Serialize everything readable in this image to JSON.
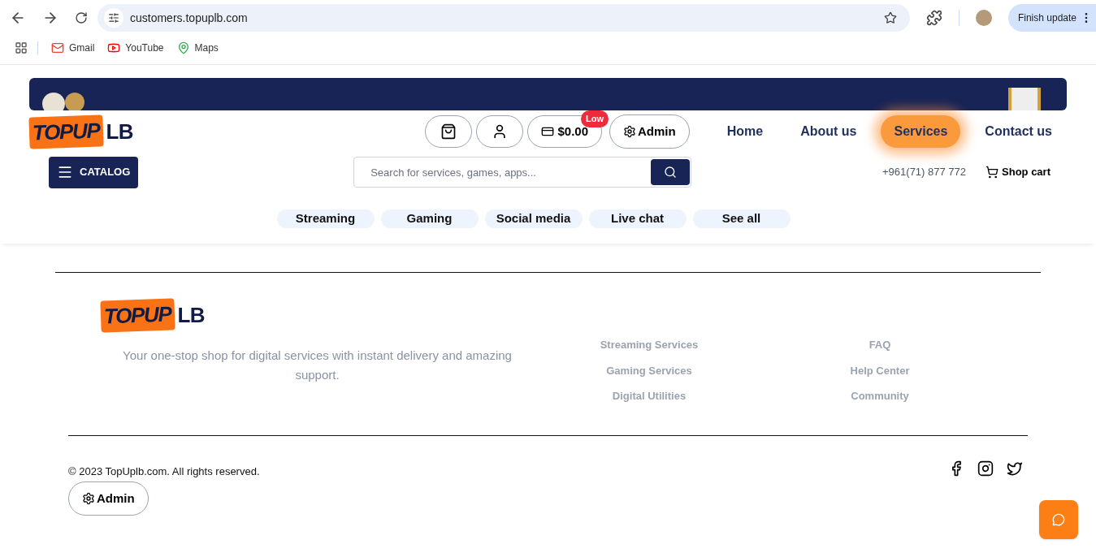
{
  "browser": {
    "url": "customers.topuplb.com",
    "update_button": "Finish update",
    "bookmarks": [
      {
        "label": "Gmail",
        "kind": "gmail"
      },
      {
        "label": "YouTube",
        "kind": "youtube"
      },
      {
        "label": "Maps",
        "kind": "maps"
      }
    ]
  },
  "header": {
    "logo": {
      "main": "TOPUP",
      "suffix": "LB"
    },
    "balance": "$0.00",
    "balance_badge": "Low",
    "admin": "Admin",
    "nav": [
      {
        "label": "Home",
        "selected": false
      },
      {
        "label": "About us",
        "selected": false
      },
      {
        "label": "Services",
        "selected": true
      },
      {
        "label": "Contact us",
        "selected": false
      }
    ],
    "catalog": "CATALOG",
    "search": {
      "placeholder": "Search for services, games, apps..."
    },
    "phone": "+961(71) 877 772",
    "shop_cart": "Shop cart",
    "categories": [
      "Streaming",
      "Gaming",
      "Social media",
      "Live chat",
      "See all"
    ]
  },
  "footer": {
    "logo": {
      "main": "TOPUP",
      "suffix": "LB"
    },
    "tagline": "Your one-stop shop for digital services with instant delivery and amazing support.",
    "link_columns": [
      [
        "Streaming Services",
        "Gaming Services",
        "Digital Utilities"
      ],
      [
        "FAQ",
        "Help Center",
        "Community"
      ]
    ],
    "copyright": "© 2023 TopUplb.com. All rights reserved.",
    "admin": "Admin",
    "social": [
      {
        "kind": "facebook"
      },
      {
        "kind": "instagram"
      },
      {
        "kind": "twitter"
      }
    ]
  }
}
